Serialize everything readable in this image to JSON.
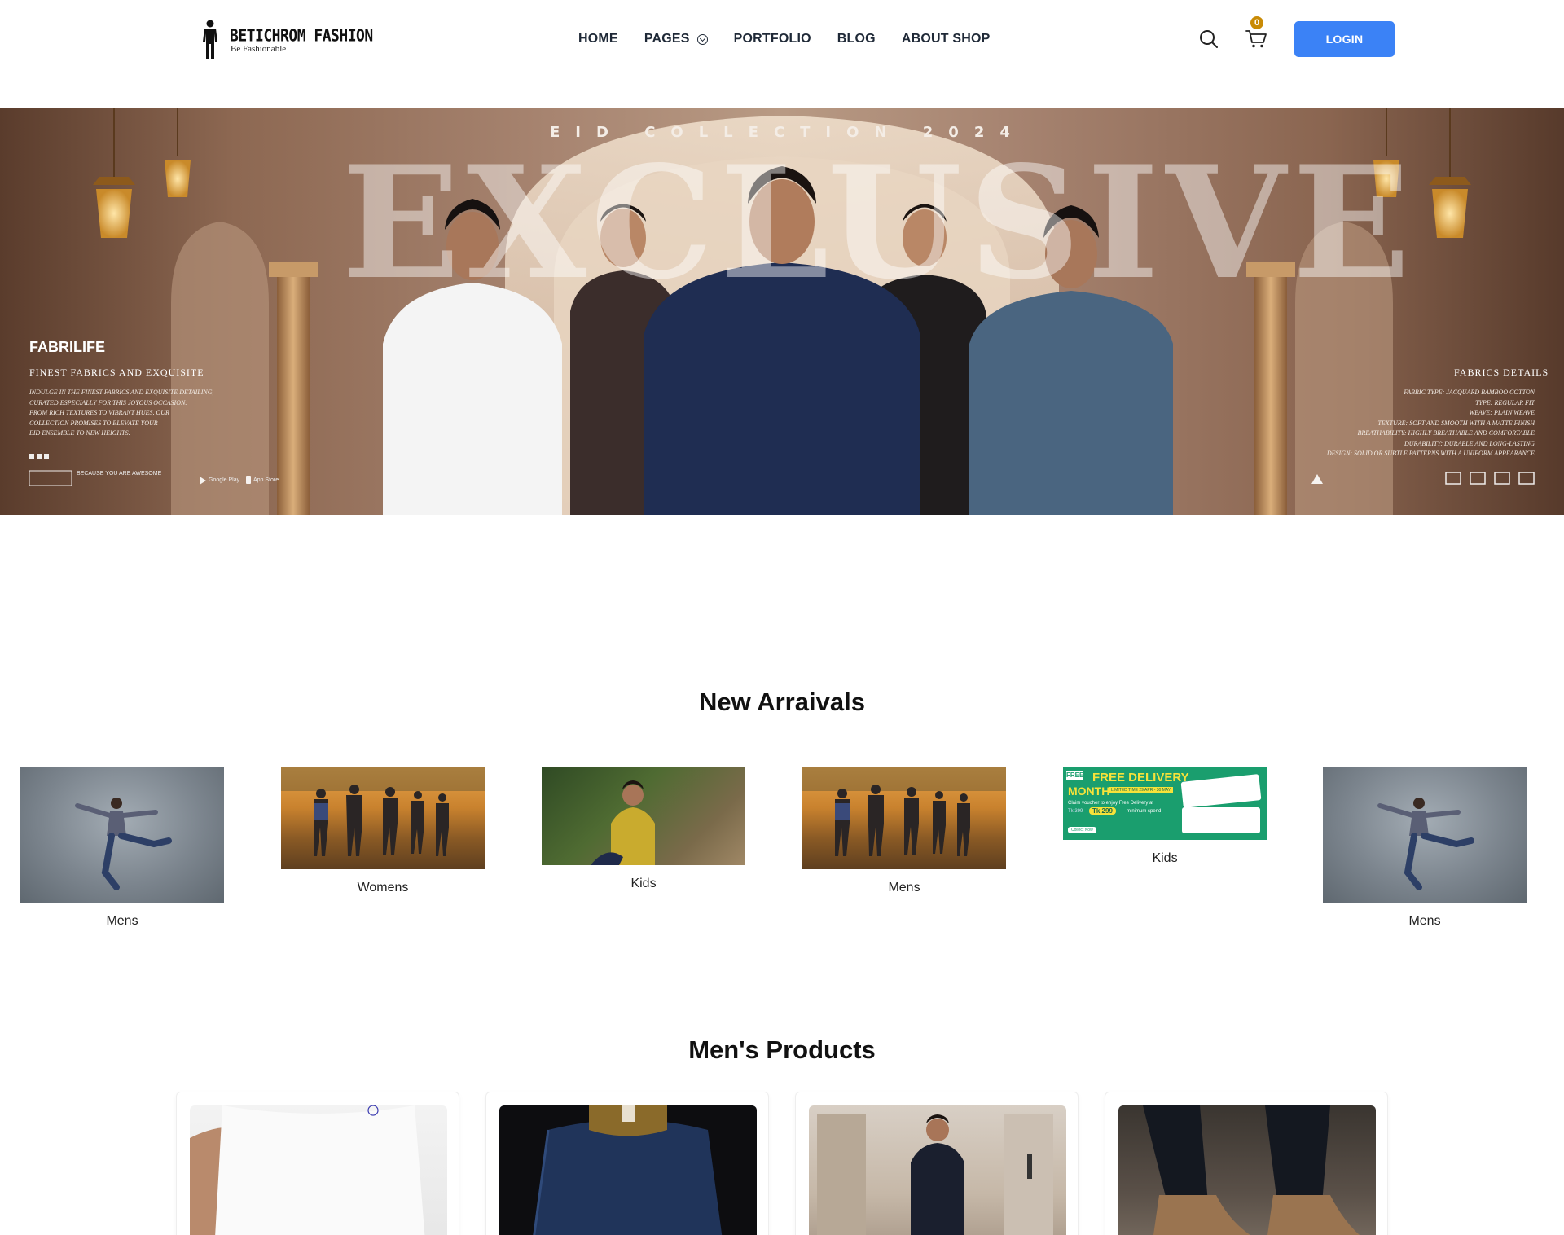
{
  "header": {
    "logo_title": "BETICHROM FASHION",
    "logo_subtitle": "Be Fashionable",
    "nav": [
      "HOME",
      "PAGES",
      "PORTFOLIO",
      "BLOG",
      "ABOUT SHOP"
    ],
    "cart_count": "0",
    "login_label": "LOGIN"
  },
  "banner": {
    "eyebrow": "EID COLLECTION 2024",
    "headline": "EXCLUSIVE",
    "brand": "FABRILIFE",
    "left_heading": "FINEST FABRICS AND EXQUISITE",
    "left_text": "INDULGE IN THE FINEST FABRICS AND EXQUISITE DETAILING,\nCURATED ESPECIALLY FOR THIS JOYOUS OCCASION.\nFROM RICH TEXTURES TO VIBRANT HUES, OUR\nCOLLECTION PROMISES TO ELEVATE YOUR\nEID ENSEMBLE TO NEW HEIGHTS.",
    "tagline": "BECAUSE YOU ARE AWESOME",
    "google_play": "Google Play",
    "app_store": "App Store",
    "right_heading": "FABRICS DETAILS",
    "right_text": "FABRIC TYPE: JACQUARD BAMBOO COTTON\nTYPE: REGULAR FIT\nWEAVE: PLAIN WEAVE\nTEXTURE: SOFT AND SMOOTH WITH A MATTE FINISH\nBREATHABILITY: HIGHLY BREATHABLE AND COMFORTABLE\nDURABILITY: DURABLE AND LONG-LASTING\nDESIGN: SOLID OR SUBTLE PATTERNS WITH A UNIFORM APPEARANCE"
  },
  "new_arrivals": {
    "title": "New Arraivals",
    "items": [
      {
        "label": "Mens",
        "image": "dancer"
      },
      {
        "label": "Womens",
        "image": "group-running"
      },
      {
        "label": "Kids",
        "image": "man-yellow-shirt"
      },
      {
        "label": "Mens",
        "image": "group-running"
      },
      {
        "label": "Kids",
        "image": "free-delivery-promo"
      },
      {
        "label": "Mens",
        "image": "dancer"
      }
    ],
    "promo": {
      "headline": "FREE DELIVERY",
      "month": "MONTH",
      "free_tag": "FREE",
      "limited": "LIMITED TIME 29 APR - 30 MAY",
      "claim": "Claim voucher to enjoy Free Delivery at",
      "old_price": "Tk 399",
      "price": "Tk 299",
      "min_spend": "minimum spend",
      "cta": "Collect Now"
    }
  },
  "mens_products": {
    "title": "Men's Products",
    "items": [
      {
        "image": "white-tshirt"
      },
      {
        "image": "denim-jacket"
      },
      {
        "image": "man-street"
      },
      {
        "image": "boots"
      }
    ]
  },
  "colors": {
    "accent": "#3b82f6",
    "badge": "#c98b06",
    "promo_green": "#1a9e6e"
  }
}
